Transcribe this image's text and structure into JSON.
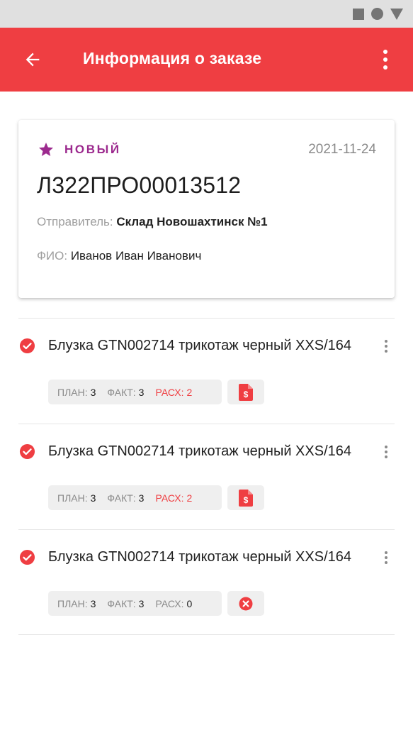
{
  "app": {
    "title": "Информация о заказе",
    "accent_color": "#ef3e42"
  },
  "order": {
    "status": "НОВЫЙ",
    "status_color": "#9c2a8e",
    "date": "2021-11-24",
    "number": "Л322ПРО00013512",
    "sender_label": "Отправитель:",
    "sender": "Склад Новошахтинск №1",
    "fio_label": "ФИО:",
    "fio": "Иванов Иван Иванович"
  },
  "labels": {
    "plan": "ПЛАН:",
    "fact": "ФАКТ:",
    "rash": "РАСХ:"
  },
  "items": [
    {
      "title": "Блузка GTN002714 трикотаж черный XXS/164",
      "plan": "3",
      "fact": "3",
      "rash": "2",
      "rash_highlight": true,
      "action_icon": "dollar-document-icon"
    },
    {
      "title": "Блузка GTN002714 трикотаж черный XXS/164",
      "plan": "3",
      "fact": "3",
      "rash": "2",
      "rash_highlight": true,
      "action_icon": "dollar-document-icon"
    },
    {
      "title": "Блузка GTN002714 трикотаж черный XXS/164",
      "plan": "3",
      "fact": "3",
      "rash": "0",
      "rash_highlight": false,
      "action_icon": "close-circle-icon"
    }
  ]
}
